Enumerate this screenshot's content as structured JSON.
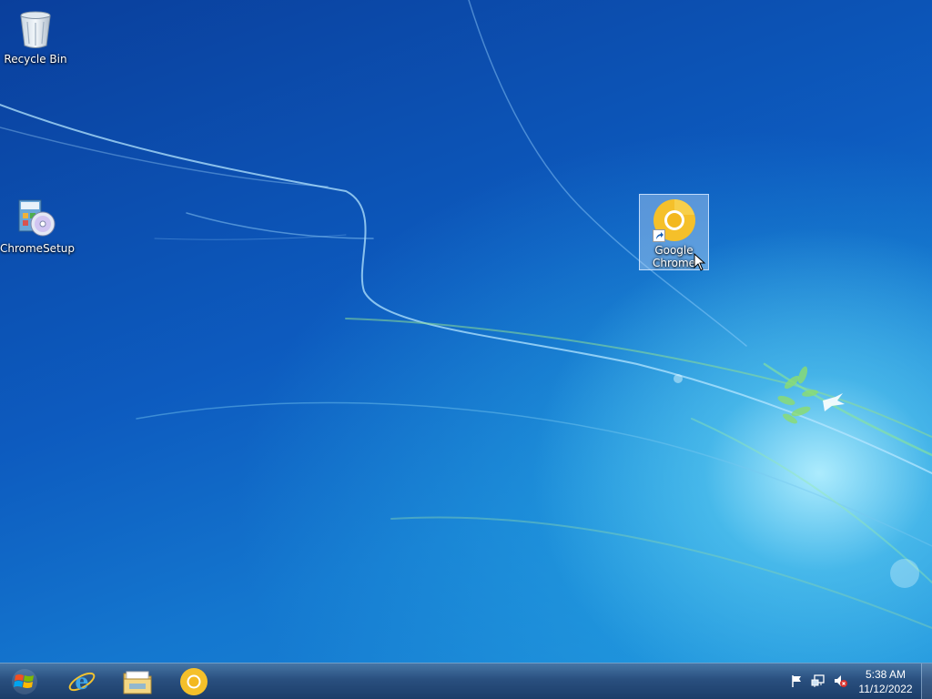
{
  "desktop": {
    "icons": [
      {
        "label": "Recycle Bin",
        "icon": "recycle-bin-icon"
      },
      {
        "label": "ChromeSetup",
        "icon": "installer-disc-icon"
      },
      {
        "label": "Google Chrome",
        "icon": "chrome-icon",
        "selected": true
      }
    ]
  },
  "taskbar": {
    "pinned": [
      {
        "name": "Internet Explorer",
        "icon": "internet-explorer-icon"
      },
      {
        "name": "Windows Explorer",
        "icon": "folder-explorer-icon"
      },
      {
        "name": "Google Chrome",
        "icon": "chrome-icon"
      }
    ],
    "tray": {
      "icons": [
        "action-center-flag-icon",
        "network-icon",
        "volume-muted-icon"
      ],
      "time": "5:38 AM",
      "date": "11/12/2022"
    }
  },
  "colors": {
    "taskbar": "#1e4a7a",
    "chrome_yellow": "#f5c02a",
    "selection": "#b4d2f5"
  }
}
